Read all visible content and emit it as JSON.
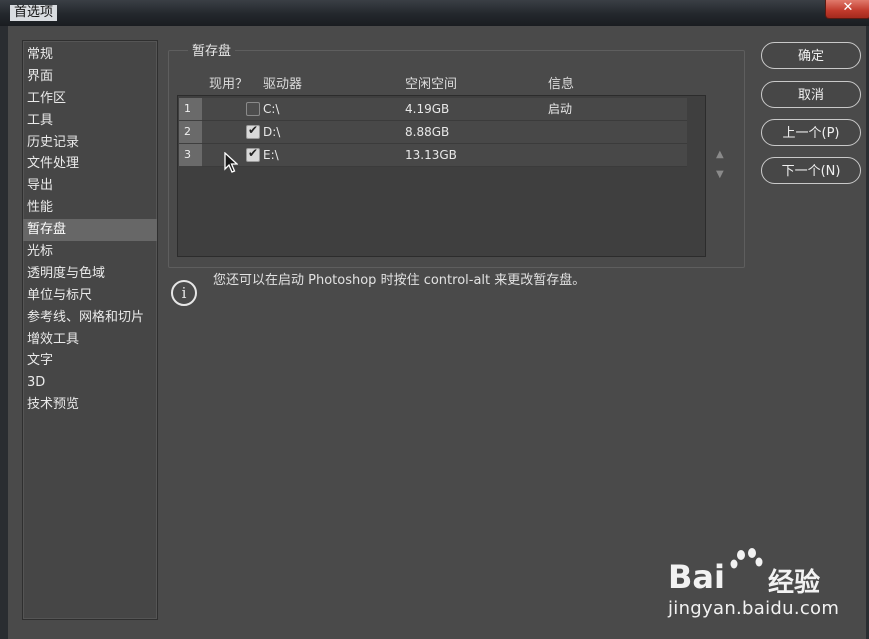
{
  "window": {
    "title": "首选项",
    "close_label": "✕"
  },
  "sidebar": {
    "items": [
      {
        "label": "常规"
      },
      {
        "label": "界面"
      },
      {
        "label": "工作区"
      },
      {
        "label": "工具"
      },
      {
        "label": "历史记录"
      },
      {
        "label": "文件处理"
      },
      {
        "label": "导出"
      },
      {
        "label": "性能"
      },
      {
        "label": "暂存盘",
        "active": true
      },
      {
        "label": "光标"
      },
      {
        "label": "透明度与色域"
      },
      {
        "label": "单位与标尺"
      },
      {
        "label": "参考线、网格和切片"
      },
      {
        "label": "增效工具"
      },
      {
        "label": "文字"
      },
      {
        "label": "3D"
      },
      {
        "label": "技术预览"
      }
    ]
  },
  "scratch": {
    "group_title": "暂存盘",
    "columns": {
      "active": "现用？",
      "drive": "驱动器",
      "free": "空闲空间",
      "info": "信息"
    },
    "rows": [
      {
        "num": "1",
        "checked": false,
        "drive": "C:\\",
        "free": "4.19GB",
        "info": "启动"
      },
      {
        "num": "2",
        "checked": true,
        "drive": "D:\\",
        "free": "8.88GB",
        "info": ""
      },
      {
        "num": "3",
        "checked": true,
        "drive": "E:\\",
        "free": "13.13GB",
        "info": ""
      }
    ],
    "move_up_icon": "triangle-up-icon",
    "move_down_icon": "triangle-down-icon"
  },
  "info_note": {
    "icon": "info-icon",
    "text": "您还可以在启动 Photoshop 时按住 control-alt 来更改暂存盘。"
  },
  "buttons": {
    "ok": "确定",
    "cancel": "取消",
    "prev": "上一个(P)",
    "next": "下一个(N)"
  },
  "watermark": {
    "brand": "Bai",
    "brand_cn": "经验",
    "url": "jingyan.baidu.com"
  }
}
